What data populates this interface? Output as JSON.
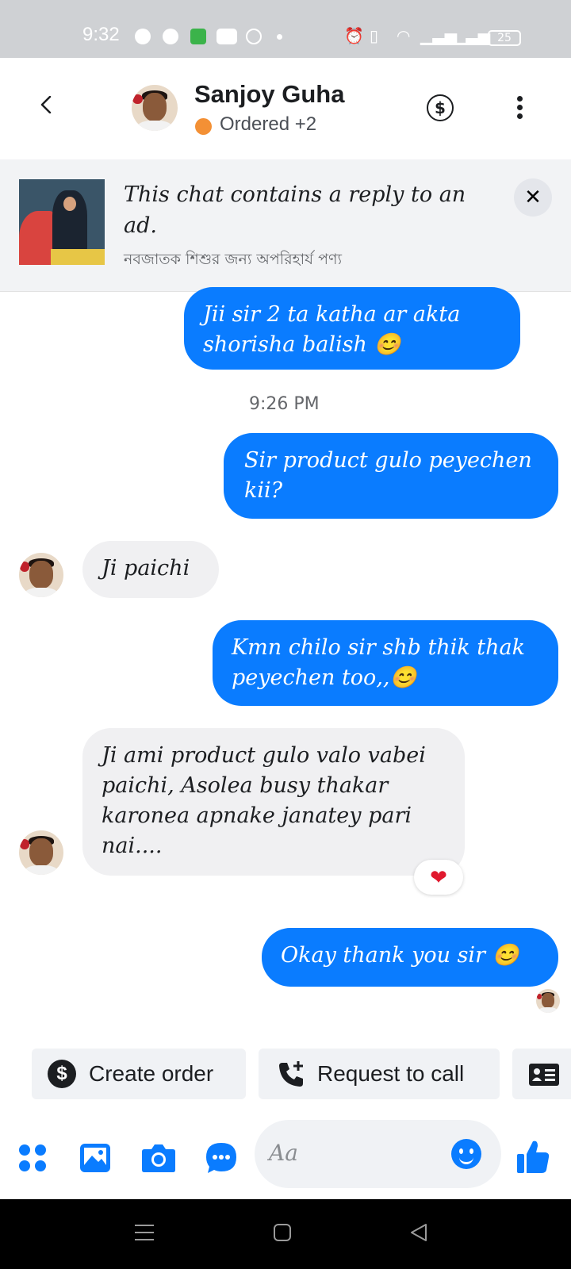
{
  "status_bar": {
    "time": "9:32",
    "battery": "25"
  },
  "header": {
    "contact_name": "Sanjoy Guha",
    "status_label": "Ordered +2",
    "status_color": "#f39035",
    "icons": [
      "back-arrow-icon",
      "dollar-icon",
      "more-vertical-icon"
    ]
  },
  "ad_banner": {
    "title": "This chat contains a reply to an ad.",
    "subtitle": "নবজাতক শিশুর জন্য অপরিহার্য  পণ্য",
    "close_label": "✕"
  },
  "messages": [
    {
      "direction": "out",
      "text": "Jii sir 2 ta katha ar akta shorisha balish 😊"
    },
    {
      "type": "timestamp",
      "text": "9:26 PM"
    },
    {
      "direction": "out",
      "text": "Sir product gulo peyechen kii?"
    },
    {
      "direction": "in",
      "text": "Ji paichi"
    },
    {
      "direction": "out",
      "text": "Kmn chilo sir shb thik thak peyechen too,,😊"
    },
    {
      "direction": "in",
      "text": "Ji ami product gulo valo vabei paichi, Asolea busy thakar karonea apnake janatey pari nai....",
      "reaction": "❤"
    },
    {
      "direction": "out",
      "text": "Okay thank you sir 😊"
    }
  ],
  "quick_actions": {
    "create_order": "Create order",
    "request_call": "Request to call"
  },
  "composer": {
    "placeholder": "Aa",
    "icons": [
      "apps-icon",
      "gallery-icon",
      "camera-icon",
      "chat-bubble-icon",
      "emoji-icon",
      "thumbs-up-icon"
    ]
  },
  "colors": {
    "accent": "#0a7cff",
    "incoming_bubble": "#f0f0f2"
  }
}
